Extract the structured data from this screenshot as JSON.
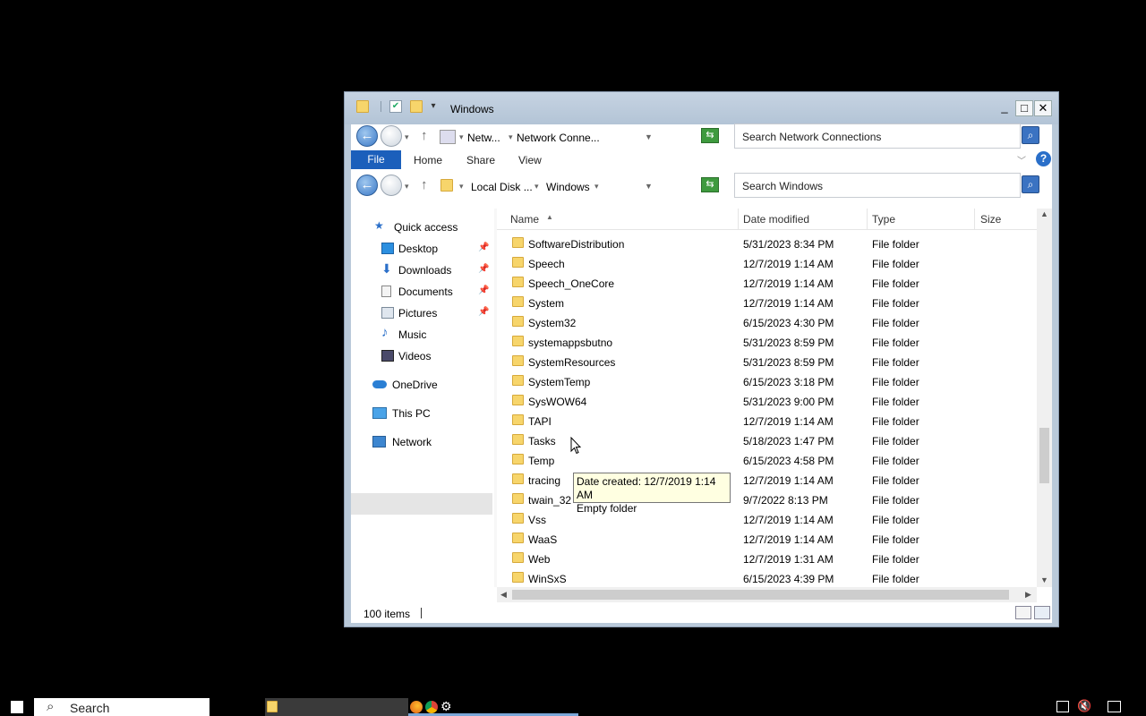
{
  "window": {
    "title": "Windows",
    "buttons": {
      "minimize": "_",
      "maximize": "□",
      "close": "✕"
    }
  },
  "nav_top": {
    "breadcrumb": [
      "Netw...",
      "Network Conne..."
    ],
    "search_placeholder": "Search Network Connections"
  },
  "ribbon": {
    "tabs": [
      "File",
      "Home",
      "Share",
      "View"
    ]
  },
  "nav_main": {
    "breadcrumb": [
      "Local Disk ...",
      "Windows"
    ],
    "search_placeholder": "Search Windows"
  },
  "nav_pane": {
    "items": [
      {
        "label": "Quick access",
        "icon": "star-icon"
      },
      {
        "label": "Desktop",
        "icon": "desktop-icon",
        "pinned": true
      },
      {
        "label": "Downloads",
        "icon": "download-icon",
        "pinned": true
      },
      {
        "label": "Documents",
        "icon": "documents-icon",
        "pinned": true
      },
      {
        "label": "Pictures",
        "icon": "pictures-icon",
        "pinned": true
      },
      {
        "label": "Music",
        "icon": "music-icon"
      },
      {
        "label": "Videos",
        "icon": "videos-icon"
      },
      {
        "label": "OneDrive",
        "icon": "cloud-icon"
      },
      {
        "label": "This PC",
        "icon": "computer-icon",
        "selected": true
      },
      {
        "label": "Network",
        "icon": "network-icon"
      }
    ]
  },
  "file_list": {
    "columns": [
      "Name",
      "Date modified",
      "Type",
      "Size"
    ],
    "rows": [
      {
        "name": "SoftwareDistribution",
        "date": "5/31/2023 8:34 PM",
        "type": "File folder"
      },
      {
        "name": "Speech",
        "date": "12/7/2019 1:14 AM",
        "type": "File folder"
      },
      {
        "name": "Speech_OneCore",
        "date": "12/7/2019 1:14 AM",
        "type": "File folder"
      },
      {
        "name": "System",
        "date": "12/7/2019 1:14 AM",
        "type": "File folder"
      },
      {
        "name": "System32",
        "date": "6/15/2023 4:30 PM",
        "type": "File folder"
      },
      {
        "name": "systemappsbutno",
        "date": "5/31/2023 8:59 PM",
        "type": "File folder"
      },
      {
        "name": "SystemResources",
        "date": "5/31/2023 8:59 PM",
        "type": "File folder"
      },
      {
        "name": "SystemTemp",
        "date": "6/15/2023 3:18 PM",
        "type": "File folder"
      },
      {
        "name": "SysWOW64",
        "date": "5/31/2023 9:00 PM",
        "type": "File folder"
      },
      {
        "name": "TAPI",
        "date": "12/7/2019 1:14 AM",
        "type": "File folder"
      },
      {
        "name": "Tasks",
        "date": "5/18/2023 1:47 PM",
        "type": "File folder"
      },
      {
        "name": "Temp",
        "date": "6/15/2023 4:58 PM",
        "type": "File folder"
      },
      {
        "name": "tracing",
        "date": "12/7/2019 1:14 AM",
        "type": "File folder"
      },
      {
        "name": "twain_32",
        "date": "9/7/2022 8:13 PM",
        "type": "File folder"
      },
      {
        "name": "Vss",
        "date": "12/7/2019 1:14 AM",
        "type": "File folder"
      },
      {
        "name": "WaaS",
        "date": "12/7/2019 1:14 AM",
        "type": "File folder"
      },
      {
        "name": "Web",
        "date": "12/7/2019 1:31 AM",
        "type": "File folder"
      },
      {
        "name": "WinSxS",
        "date": "6/15/2023 4:39 PM",
        "type": "File folder"
      }
    ]
  },
  "status": {
    "item_count": "100 items"
  },
  "tooltip": {
    "line1": "Date created: 12/7/2019 1:14 AM",
    "line2": "Empty folder"
  },
  "taskbar": {
    "search_label": "Search"
  },
  "colors": {
    "accent": "#1b5fbb",
    "folder": "#f7d56b",
    "titlebar": "#b9c9d9"
  }
}
